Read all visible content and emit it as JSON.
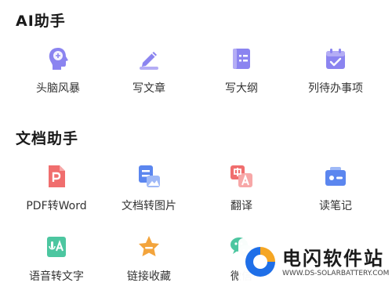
{
  "sections": [
    {
      "title": "AI助手",
      "items": [
        {
          "label": "头脑风暴",
          "icon": "brain-head-icon"
        },
        {
          "label": "写文章",
          "icon": "pencil-icon"
        },
        {
          "label": "写大纲",
          "icon": "outline-book-icon"
        },
        {
          "label": "列待办事项",
          "icon": "calendar-check-icon"
        }
      ]
    },
    {
      "title": "文档助手",
      "items": [
        {
          "label": "PDF转Word",
          "icon": "pdf-file-icon"
        },
        {
          "label": "文档转图片",
          "icon": "doc-to-image-icon"
        },
        {
          "label": "翻译",
          "icon": "translate-icon"
        },
        {
          "label": "读笔记",
          "icon": "note-card-icon"
        },
        {
          "label": "语音转文字",
          "icon": "speech-to-text-icon"
        },
        {
          "label": "链接收藏",
          "icon": "star-bookmark-icon"
        },
        {
          "label": "微信",
          "icon": "wechat-icon"
        }
      ]
    }
  ],
  "watermark": {
    "name": "电闪软件站",
    "url": "WWW.DS-SOLARBATTERY.COM"
  },
  "colors": {
    "purple": "#8b84f0",
    "lavender": "#b4adf5",
    "red": "#f06e6e",
    "blue": "#5b86ef",
    "green": "#4cc6a0",
    "orange": "#f3a43c",
    "brand_blue": "#1f6fe8",
    "brand_orange": "#f5a623"
  }
}
